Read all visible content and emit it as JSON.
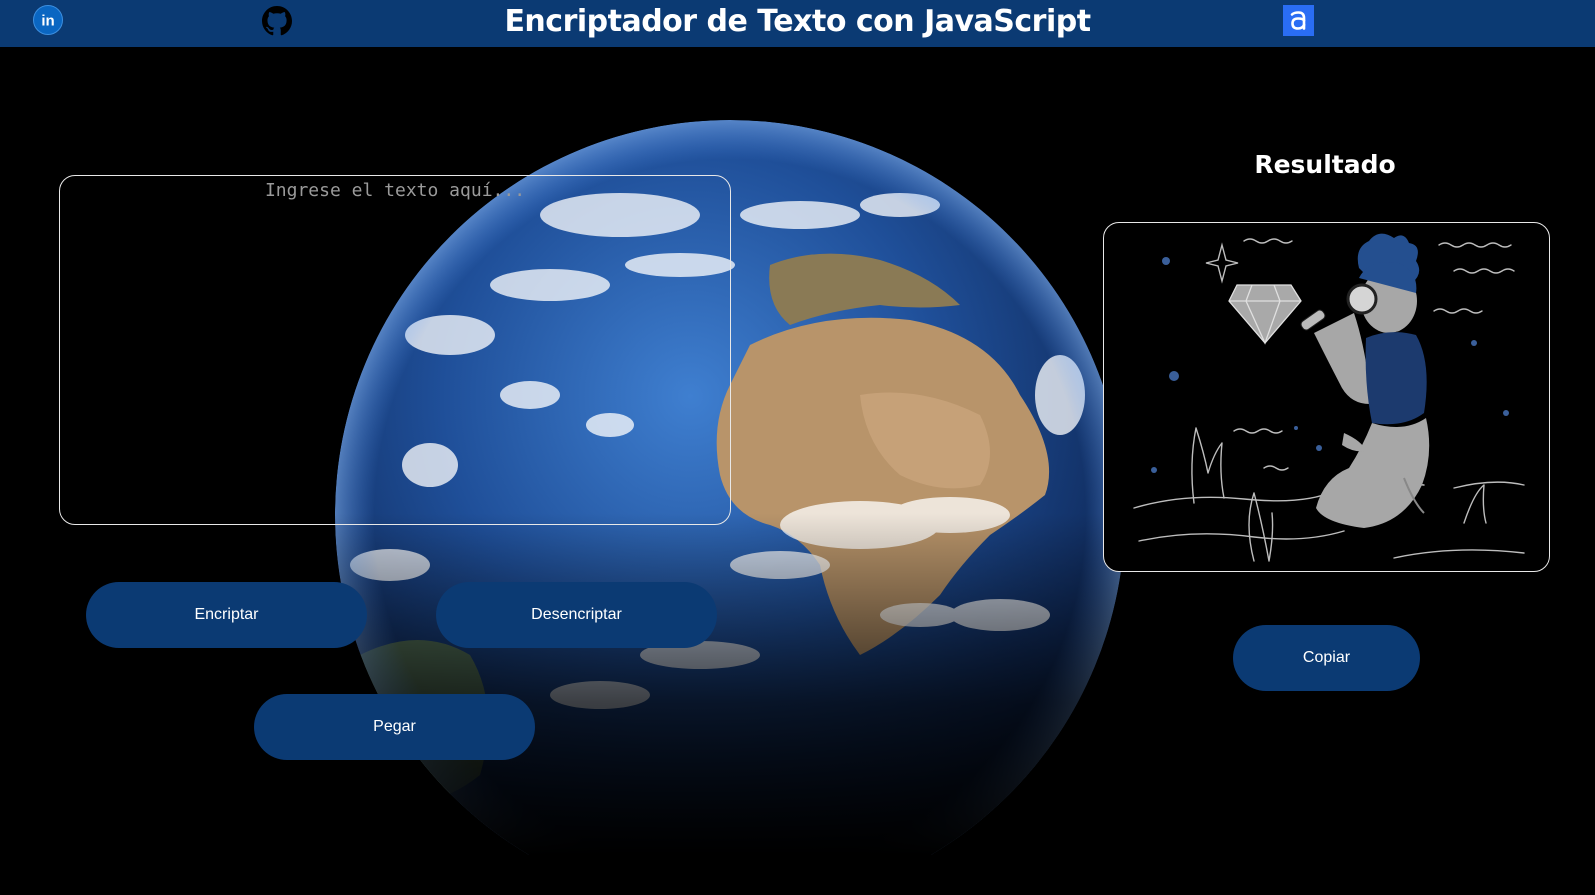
{
  "header": {
    "title": "Encriptador de Texto con JavaScript",
    "links": [
      {
        "name": "linkedin",
        "icon": "linkedin-icon"
      },
      {
        "name": "github",
        "icon": "github-icon"
      },
      {
        "name": "alura",
        "icon": "alura-icon"
      }
    ]
  },
  "input": {
    "placeholder": "Ingrese el texto aquí...",
    "value": ""
  },
  "actions": {
    "encrypt_label": "Encriptar",
    "decrypt_label": "Desencriptar",
    "paste_label": "Pegar"
  },
  "result": {
    "title": "Resultado",
    "illustration": "person-with-magnifying-glass-and-diamond",
    "copy_label": "Copiar"
  },
  "background": {
    "image": "earth-globe"
  },
  "colors": {
    "header_bg": "#0b3a73",
    "button_bg": "#0b3a73",
    "page_bg": "#000000",
    "text": "#ffffff"
  }
}
